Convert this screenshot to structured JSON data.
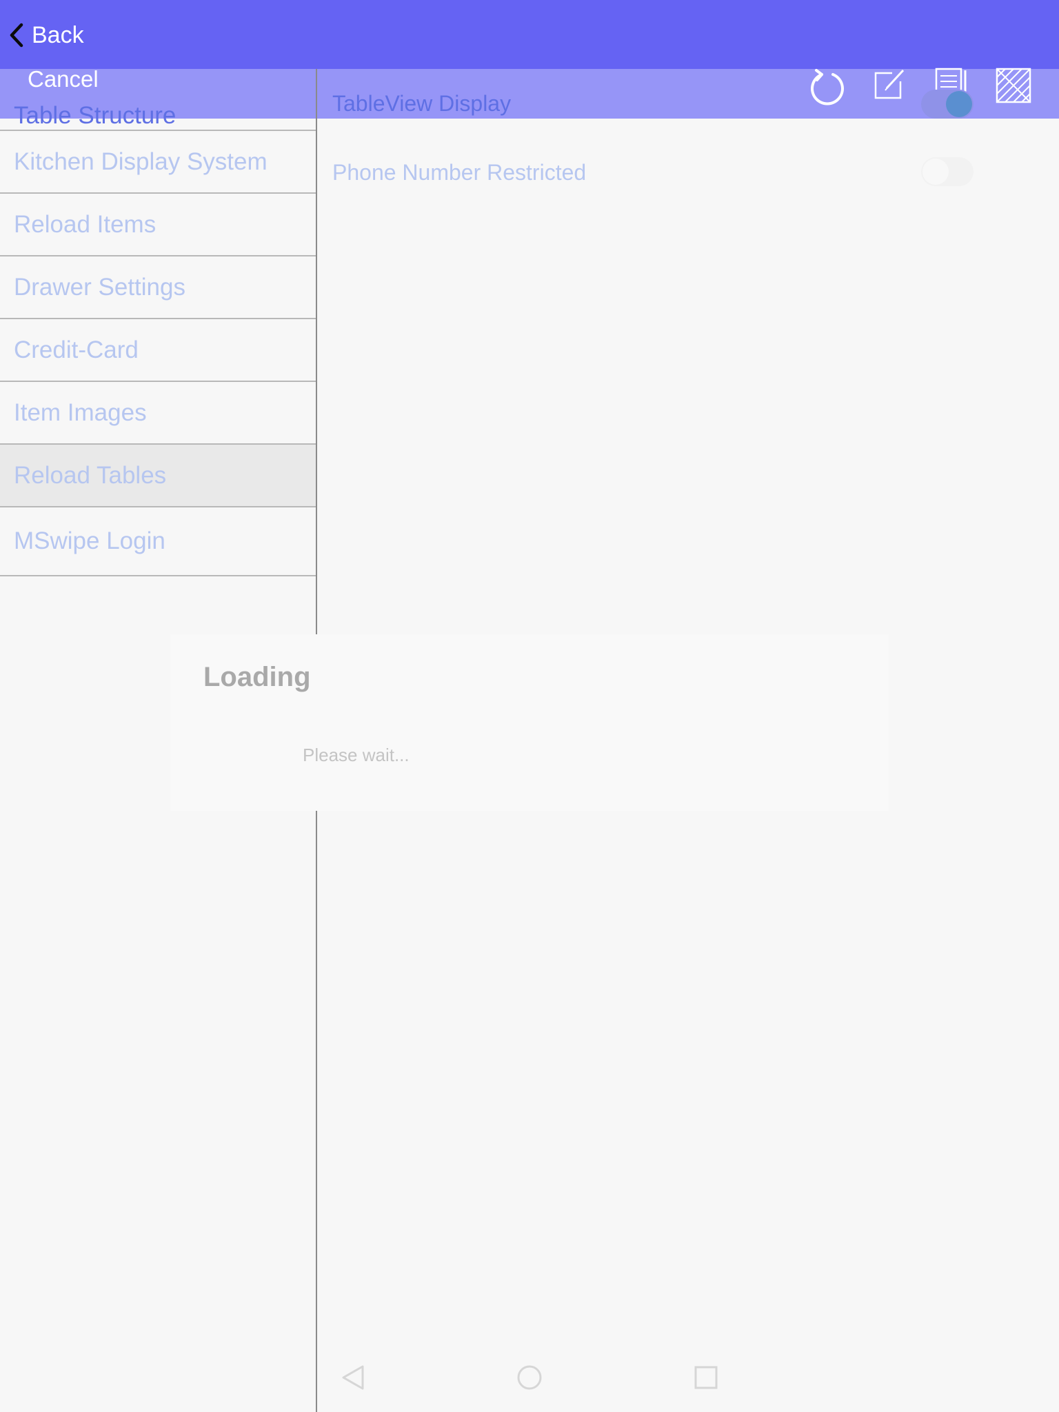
{
  "header": {
    "back_label": "Back",
    "cancel_label": "Cancel",
    "toolbar_icons": [
      "refresh-icon",
      "edit-icon",
      "notes-icon",
      "grid-pattern-icon"
    ]
  },
  "sidebar": {
    "items": [
      {
        "label": "Table Structure",
        "state": "active"
      },
      {
        "label": "Kitchen Display System"
      },
      {
        "label": "Reload Items"
      },
      {
        "label": "Drawer Settings"
      },
      {
        "label": "Credit-Card"
      },
      {
        "label": "Item Images"
      },
      {
        "label": "Reload Tables",
        "state": "selected"
      },
      {
        "label": "MSwipe Login"
      }
    ]
  },
  "detail": {
    "rows": [
      {
        "label": "TableView Display",
        "toggle_on": true
      },
      {
        "label": "Phone Number Restricted",
        "toggle_on": false
      }
    ]
  },
  "dialog": {
    "title": "Loading",
    "message": "Please wait..."
  },
  "system_nav": [
    "back-triangle-icon",
    "home-circle-icon",
    "recents-square-icon"
  ],
  "colors": {
    "topbar": "#6563f3",
    "subbar": "#9695f7",
    "accent_text": "#5e6fe4",
    "muted_text": "#b6c6f0",
    "toggle_knob_on": "#5a8fd0"
  }
}
